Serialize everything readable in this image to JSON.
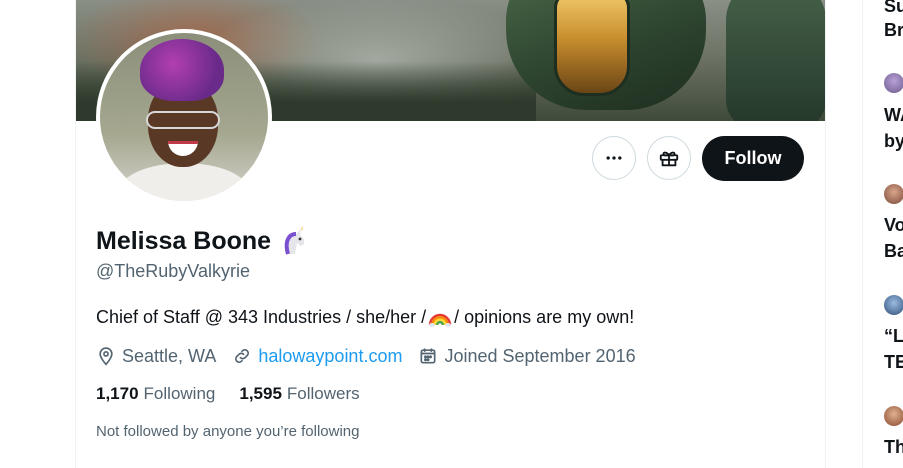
{
  "profile": {
    "display_name": "Melissa Boone",
    "handle": "@TheRubyValkyrie",
    "bio_before": "Chief of Staff @ 343 Industries / she/her / ",
    "bio_after": "/ opinions are my own!",
    "location": "Seattle, WA",
    "website": "halowaypoint.com",
    "joined": "Joined September 2016",
    "following_count": "1,170",
    "following_label": "Following",
    "followers_count": "1,595",
    "followers_label": "Followers",
    "not_followed_text": "Not followed by anyone you’re following"
  },
  "actions": {
    "follow_label": "Follow",
    "more_icon": "more-horizontal-icon",
    "gift_icon": "gift-icon"
  },
  "sidebar": {
    "trends": [
      {
        "line1": "Su",
        "line2": "Br"
      },
      {
        "line1": "WA",
        "line2": "by"
      },
      {
        "line1": "Vo",
        "line2": "Ba"
      },
      {
        "line1": "“L",
        "line2": "TE"
      },
      {
        "line1": "Th",
        "line2": ""
      }
    ]
  },
  "colors": {
    "text_primary": "#0f1419",
    "text_secondary": "#536471",
    "link": "#1d9bf0",
    "follow_button_bg": "#0f1419",
    "border": "#cfd9de"
  }
}
